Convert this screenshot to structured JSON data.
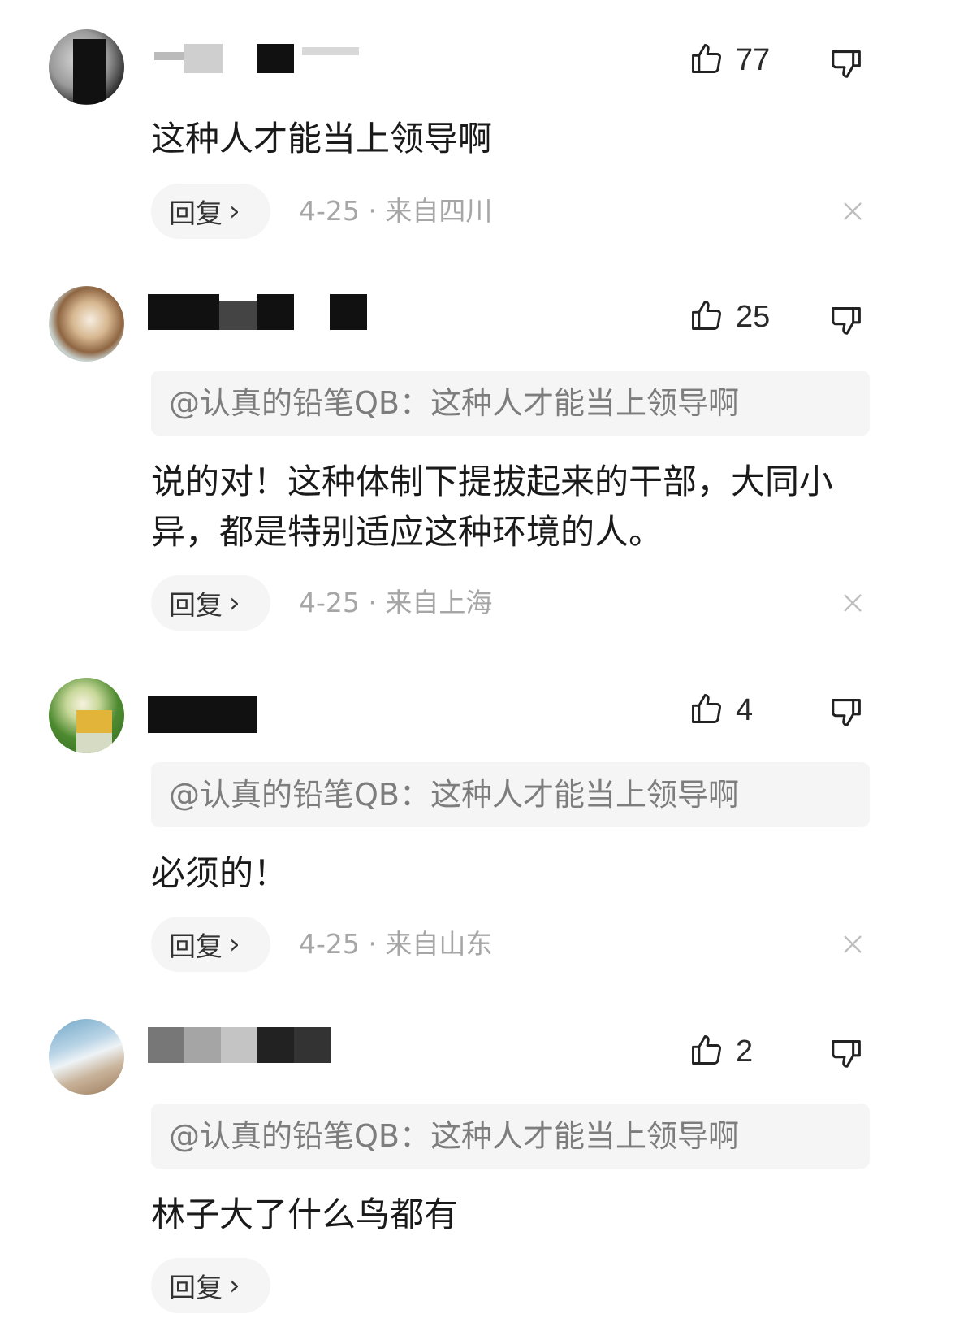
{
  "comments": [
    {
      "likes": "77",
      "body": "这种人才能当上领导啊",
      "reply_label": "回复",
      "date": "4-25",
      "location": "来自四川"
    },
    {
      "likes": "25",
      "quote": "@认真的铅笔QB：这种人才能当上领导啊",
      "body": "说的对！这种体制下提拔起来的干部，大同小异，都是特别适应这种环境的人。",
      "reply_label": "回复",
      "date": "4-25",
      "location": "来自上海"
    },
    {
      "likes": "4",
      "quote": "@认真的铅笔QB：这种人才能当上领导啊",
      "body": "必须的！",
      "reply_label": "回复",
      "date": "4-25",
      "location": "来自山东"
    },
    {
      "likes": "2",
      "quote": "@认真的铅笔QB：这种人才能当上领导啊",
      "body": "林子大了什么鸟都有",
      "reply_label": "回复"
    }
  ],
  "icons": {
    "like": "thumbs-up-icon",
    "dislike": "thumbs-down-icon",
    "close": "close-icon",
    "chevron": "chevron-right-icon"
  },
  "colors": {
    "quote_bg": "#f5f5f5",
    "meta_text": "#a6a6a6",
    "body_text": "#1a1a1a"
  }
}
